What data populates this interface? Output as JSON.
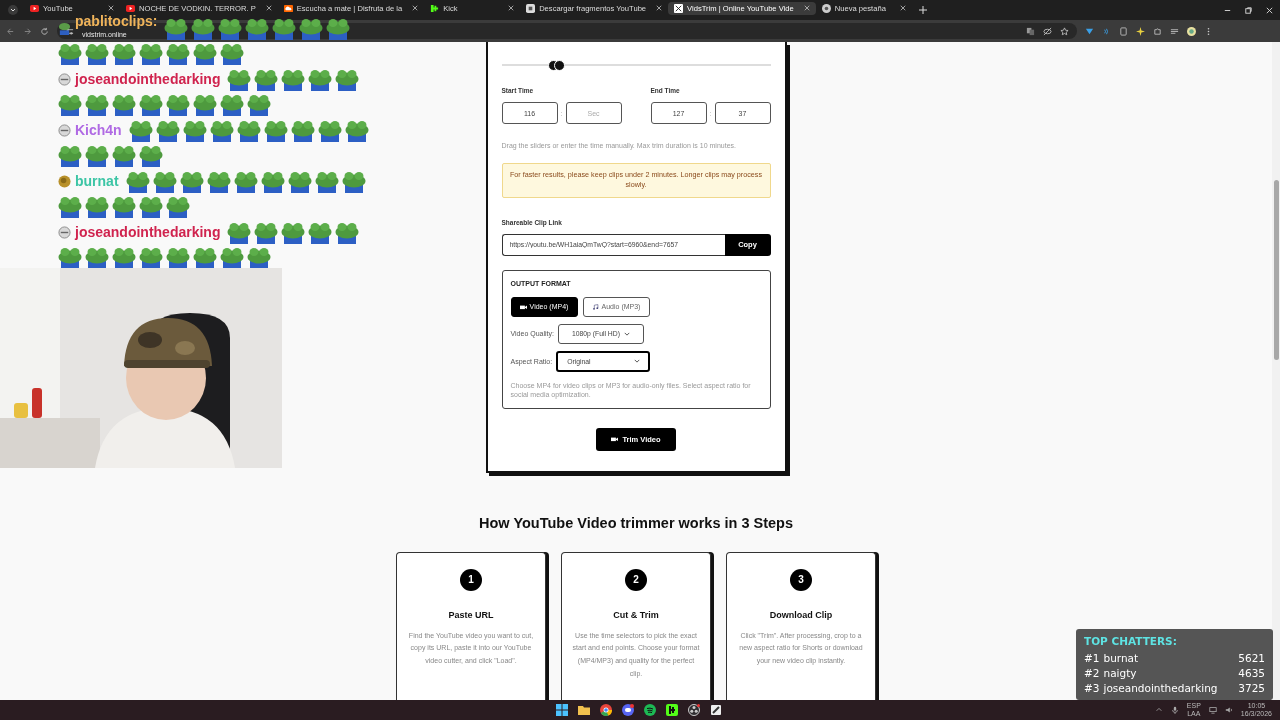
{
  "browser": {
    "tabs": [
      {
        "title": "YouTube",
        "selected": false
      },
      {
        "title": "NOCHE DE VODKIN. TERROR. P",
        "selected": false
      },
      {
        "title": "Escucha a mate | Disfruta de la",
        "selected": false
      },
      {
        "title": "Kick",
        "selected": false
      },
      {
        "title": "Descargar fragmentos YouTube",
        "selected": false
      },
      {
        "title": "VidsTrim | Online YouTube Vide",
        "selected": true
      },
      {
        "title": "Nueva pestaña",
        "selected": false
      }
    ],
    "address": "vidstrim.online"
  },
  "chat": {
    "messages": [
      {
        "user": "pablitoclips:",
        "color": "#f0b45a"
      },
      {
        "user": "joseandointhedarking",
        "color": "#d0234e"
      },
      {
        "user": "Kich4n",
        "color": "#b06ae4"
      },
      {
        "user": "burnat",
        "color": "#3cc5a5"
      },
      {
        "user": "joseandointhedarking",
        "color": "#d0234e"
      }
    ]
  },
  "trimmer": {
    "range_thumbs": [
      {
        "level": 0.19
      },
      {
        "level": 0.215
      }
    ],
    "start_time": {
      "label": "Start Time",
      "minutes": "116",
      "separator": ":",
      "seconds_placeholder": "Sec"
    },
    "end_time": {
      "label": "End Time",
      "minutes": "127",
      "separator": ":",
      "seconds": "37"
    },
    "hint": "Drag the sliders or enter the time manually. Max trim duration is 10 minutes.",
    "notice": "For faster results, please keep clips under 2 minutes. Longer clips may process slowly.",
    "link_label": "Shareable Clip Link",
    "link": "https://youtu.be/WH1aiaQmTwQ?start=6960&end=7657",
    "copy_button": "Copy",
    "output": {
      "title": "OUTPUT FORMAT",
      "formats": [
        {
          "label": "Video (MP4)",
          "selected": true
        },
        {
          "label": "Audio (MP3)",
          "selected": false
        }
      ],
      "quality_label": "Video Quality:",
      "quality": "1080p (Full HD)",
      "aspect_label": "Aspect Ratio:",
      "aspect": "Original",
      "aspect_focused": true,
      "hint": "Choose MP4 for video clips or MP3 for audio-only files. Select aspect ratio for social media optimization."
    },
    "trim_button": "Trim Video"
  },
  "steps": {
    "heading": "How YouTube Video trimmer works in 3 Steps",
    "cards": [
      {
        "number": "1",
        "title": "Paste URL",
        "text": "Find the YouTube video you want to cut, copy its URL, paste it into our YouTube video cutter, and click \"Load\"."
      },
      {
        "number": "2",
        "title": "Cut & Trim",
        "text": "Use the time selectors to pick the exact start and end points. Choose your format (MP4/MP3) and quality for the perfect clip."
      },
      {
        "number": "3",
        "title": "Download Clip",
        "text": "Click \"Trim\". After processing, crop to a new aspect ratio for Shorts or download your new video clip instantly."
      }
    ]
  },
  "top_chatters": {
    "title": "TOP CHATTERS:",
    "rows": [
      {
        "rank": "#1",
        "name": "burnat",
        "count": "5621"
      },
      {
        "rank": "#2",
        "name": "naigty",
        "count": "4635"
      },
      {
        "rank": "#3",
        "name": "joseandointhedarking",
        "count": "3725"
      }
    ]
  },
  "taskbar": {
    "language": "ESP",
    "layout": "LAA",
    "time": "10:05",
    "date": "16/3/2026"
  }
}
